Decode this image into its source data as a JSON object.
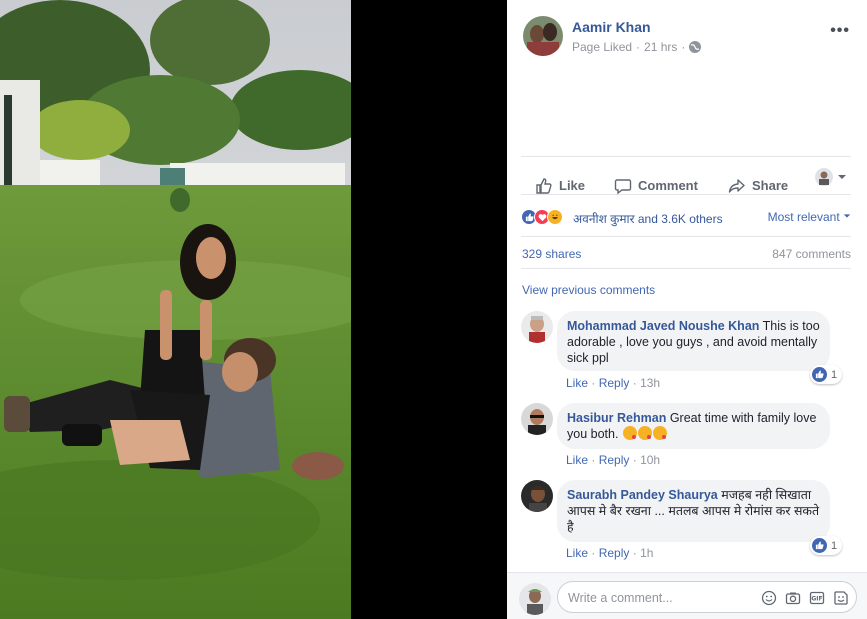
{
  "post": {
    "author": "Aamir Khan",
    "status": "Page Liked",
    "time": "21 hrs",
    "privacy_icon": "globe-icon",
    "more_label": "•••"
  },
  "actions": {
    "like": "Like",
    "comment": "Comment",
    "share": "Share"
  },
  "reactions": {
    "icons": [
      "like-icon",
      "love-icon",
      "haha-icon"
    ],
    "summary": "अवनीश कुमार and 3.6K others",
    "sort": "Most relevant"
  },
  "stats": {
    "shares": "329 shares",
    "comments": "847 comments"
  },
  "view_previous": "View previous comments",
  "comments": [
    {
      "name": "Mohammad Javed Noushe Khan",
      "text_first": "This is",
      "text_rest": "too adorable , love you guys , and avoid mentally sick ppl",
      "like": "Like",
      "reply": "Reply",
      "time": "13h",
      "likes": "1"
    },
    {
      "name": "Hasibur Rehman",
      "text_first": "Great time with family",
      "text_rest": "love you both.",
      "like": "Like",
      "reply": "Reply",
      "time": "10h",
      "likes": ""
    },
    {
      "name": "Saurabh Pandey Shaurya",
      "text_first": "मजहब नही",
      "text_rest": "सिखाता आपस मे बैर रखना ... मतलब आपस मे रोमांस कर सकते है",
      "like": "Like",
      "reply": "Reply",
      "time": "1h",
      "likes": "1"
    }
  ],
  "composer": {
    "placeholder": "Write a comment...",
    "icons": [
      "emoji-icon",
      "camera-icon",
      "gif-icon",
      "sticker-icon"
    ]
  },
  "colors": {
    "link": "#365899",
    "accent": "#4267b2",
    "muted": "#90949c",
    "bubble": "#f2f3f5"
  }
}
